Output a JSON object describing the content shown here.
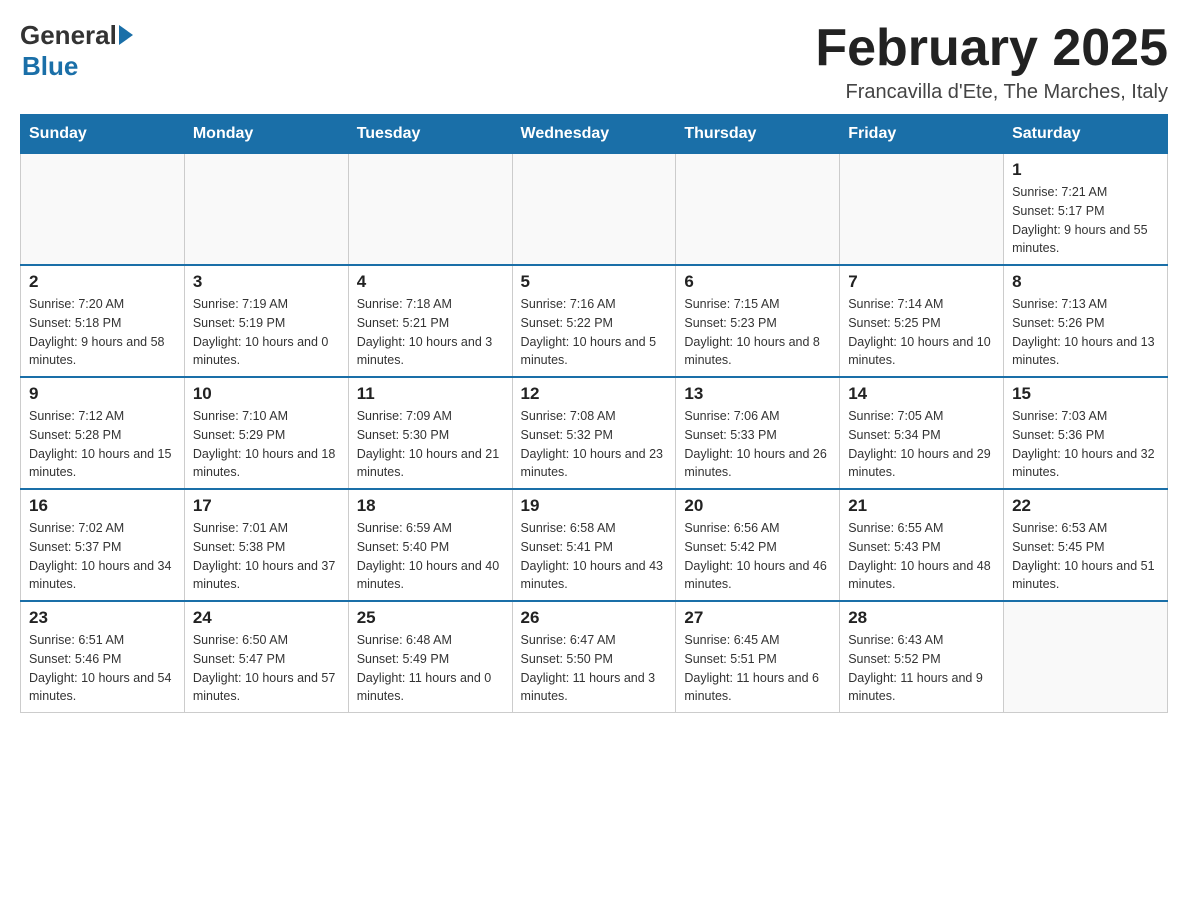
{
  "header": {
    "logo_general": "General",
    "logo_blue": "Blue",
    "month_title": "February 2025",
    "location": "Francavilla d'Ete, The Marches, Italy"
  },
  "weekdays": [
    "Sunday",
    "Monday",
    "Tuesday",
    "Wednesday",
    "Thursday",
    "Friday",
    "Saturday"
  ],
  "weeks": [
    [
      {
        "day": "",
        "sunrise": "",
        "sunset": "",
        "daylight": ""
      },
      {
        "day": "",
        "sunrise": "",
        "sunset": "",
        "daylight": ""
      },
      {
        "day": "",
        "sunrise": "",
        "sunset": "",
        "daylight": ""
      },
      {
        "day": "",
        "sunrise": "",
        "sunset": "",
        "daylight": ""
      },
      {
        "day": "",
        "sunrise": "",
        "sunset": "",
        "daylight": ""
      },
      {
        "day": "",
        "sunrise": "",
        "sunset": "",
        "daylight": ""
      },
      {
        "day": "1",
        "sunrise": "Sunrise: 7:21 AM",
        "sunset": "Sunset: 5:17 PM",
        "daylight": "Daylight: 9 hours and 55 minutes."
      }
    ],
    [
      {
        "day": "2",
        "sunrise": "Sunrise: 7:20 AM",
        "sunset": "Sunset: 5:18 PM",
        "daylight": "Daylight: 9 hours and 58 minutes."
      },
      {
        "day": "3",
        "sunrise": "Sunrise: 7:19 AM",
        "sunset": "Sunset: 5:19 PM",
        "daylight": "Daylight: 10 hours and 0 minutes."
      },
      {
        "day": "4",
        "sunrise": "Sunrise: 7:18 AM",
        "sunset": "Sunset: 5:21 PM",
        "daylight": "Daylight: 10 hours and 3 minutes."
      },
      {
        "day": "5",
        "sunrise": "Sunrise: 7:16 AM",
        "sunset": "Sunset: 5:22 PM",
        "daylight": "Daylight: 10 hours and 5 minutes."
      },
      {
        "day": "6",
        "sunrise": "Sunrise: 7:15 AM",
        "sunset": "Sunset: 5:23 PM",
        "daylight": "Daylight: 10 hours and 8 minutes."
      },
      {
        "day": "7",
        "sunrise": "Sunrise: 7:14 AM",
        "sunset": "Sunset: 5:25 PM",
        "daylight": "Daylight: 10 hours and 10 minutes."
      },
      {
        "day": "8",
        "sunrise": "Sunrise: 7:13 AM",
        "sunset": "Sunset: 5:26 PM",
        "daylight": "Daylight: 10 hours and 13 minutes."
      }
    ],
    [
      {
        "day": "9",
        "sunrise": "Sunrise: 7:12 AM",
        "sunset": "Sunset: 5:28 PM",
        "daylight": "Daylight: 10 hours and 15 minutes."
      },
      {
        "day": "10",
        "sunrise": "Sunrise: 7:10 AM",
        "sunset": "Sunset: 5:29 PM",
        "daylight": "Daylight: 10 hours and 18 minutes."
      },
      {
        "day": "11",
        "sunrise": "Sunrise: 7:09 AM",
        "sunset": "Sunset: 5:30 PM",
        "daylight": "Daylight: 10 hours and 21 minutes."
      },
      {
        "day": "12",
        "sunrise": "Sunrise: 7:08 AM",
        "sunset": "Sunset: 5:32 PM",
        "daylight": "Daylight: 10 hours and 23 minutes."
      },
      {
        "day": "13",
        "sunrise": "Sunrise: 7:06 AM",
        "sunset": "Sunset: 5:33 PM",
        "daylight": "Daylight: 10 hours and 26 minutes."
      },
      {
        "day": "14",
        "sunrise": "Sunrise: 7:05 AM",
        "sunset": "Sunset: 5:34 PM",
        "daylight": "Daylight: 10 hours and 29 minutes."
      },
      {
        "day": "15",
        "sunrise": "Sunrise: 7:03 AM",
        "sunset": "Sunset: 5:36 PM",
        "daylight": "Daylight: 10 hours and 32 minutes."
      }
    ],
    [
      {
        "day": "16",
        "sunrise": "Sunrise: 7:02 AM",
        "sunset": "Sunset: 5:37 PM",
        "daylight": "Daylight: 10 hours and 34 minutes."
      },
      {
        "day": "17",
        "sunrise": "Sunrise: 7:01 AM",
        "sunset": "Sunset: 5:38 PM",
        "daylight": "Daylight: 10 hours and 37 minutes."
      },
      {
        "day": "18",
        "sunrise": "Sunrise: 6:59 AM",
        "sunset": "Sunset: 5:40 PM",
        "daylight": "Daylight: 10 hours and 40 minutes."
      },
      {
        "day": "19",
        "sunrise": "Sunrise: 6:58 AM",
        "sunset": "Sunset: 5:41 PM",
        "daylight": "Daylight: 10 hours and 43 minutes."
      },
      {
        "day": "20",
        "sunrise": "Sunrise: 6:56 AM",
        "sunset": "Sunset: 5:42 PM",
        "daylight": "Daylight: 10 hours and 46 minutes."
      },
      {
        "day": "21",
        "sunrise": "Sunrise: 6:55 AM",
        "sunset": "Sunset: 5:43 PM",
        "daylight": "Daylight: 10 hours and 48 minutes."
      },
      {
        "day": "22",
        "sunrise": "Sunrise: 6:53 AM",
        "sunset": "Sunset: 5:45 PM",
        "daylight": "Daylight: 10 hours and 51 minutes."
      }
    ],
    [
      {
        "day": "23",
        "sunrise": "Sunrise: 6:51 AM",
        "sunset": "Sunset: 5:46 PM",
        "daylight": "Daylight: 10 hours and 54 minutes."
      },
      {
        "day": "24",
        "sunrise": "Sunrise: 6:50 AM",
        "sunset": "Sunset: 5:47 PM",
        "daylight": "Daylight: 10 hours and 57 minutes."
      },
      {
        "day": "25",
        "sunrise": "Sunrise: 6:48 AM",
        "sunset": "Sunset: 5:49 PM",
        "daylight": "Daylight: 11 hours and 0 minutes."
      },
      {
        "day": "26",
        "sunrise": "Sunrise: 6:47 AM",
        "sunset": "Sunset: 5:50 PM",
        "daylight": "Daylight: 11 hours and 3 minutes."
      },
      {
        "day": "27",
        "sunrise": "Sunrise: 6:45 AM",
        "sunset": "Sunset: 5:51 PM",
        "daylight": "Daylight: 11 hours and 6 minutes."
      },
      {
        "day": "28",
        "sunrise": "Sunrise: 6:43 AM",
        "sunset": "Sunset: 5:52 PM",
        "daylight": "Daylight: 11 hours and 9 minutes."
      },
      {
        "day": "",
        "sunrise": "",
        "sunset": "",
        "daylight": ""
      }
    ]
  ]
}
